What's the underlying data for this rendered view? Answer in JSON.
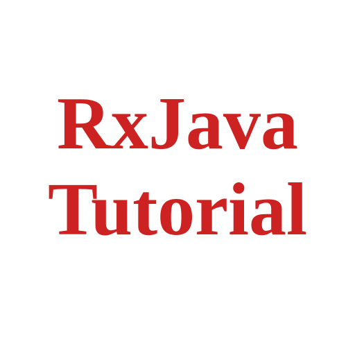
{
  "title": {
    "line1": "RxJava",
    "line2": "Tutorial"
  }
}
